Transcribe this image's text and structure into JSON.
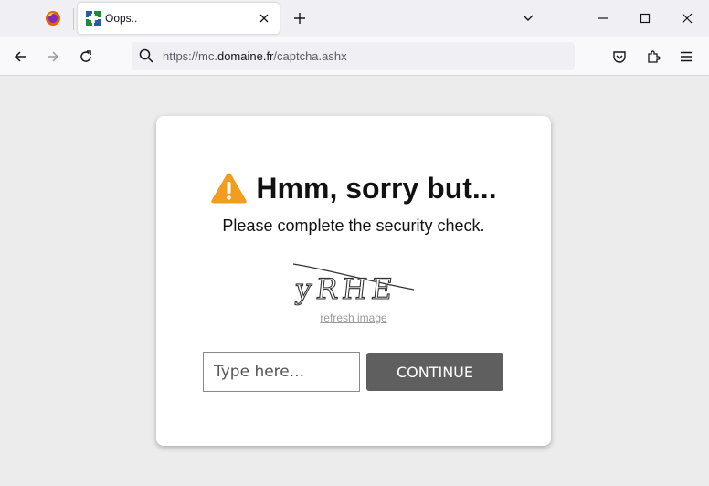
{
  "browser": {
    "tab": {
      "title": "Oops.."
    },
    "address": {
      "prefix": "https://mc.",
      "host": "domaine.fr",
      "path": "/captcha.ashx"
    }
  },
  "page": {
    "heading": "Hmm, sorry but...",
    "subtext": "Please complete the security check.",
    "captcha_text": "yRHE",
    "refresh_label": "refresh image",
    "input": {
      "placeholder": "Type here...",
      "value": ""
    },
    "continue_label": "CONTINUE"
  },
  "icons": {
    "warning": "warning-icon",
    "firefox": "firefox-icon",
    "favicon": "site-favicon-icon"
  },
  "colors": {
    "warning": "#f39c1f",
    "continue_button": "#5f5f5f"
  }
}
